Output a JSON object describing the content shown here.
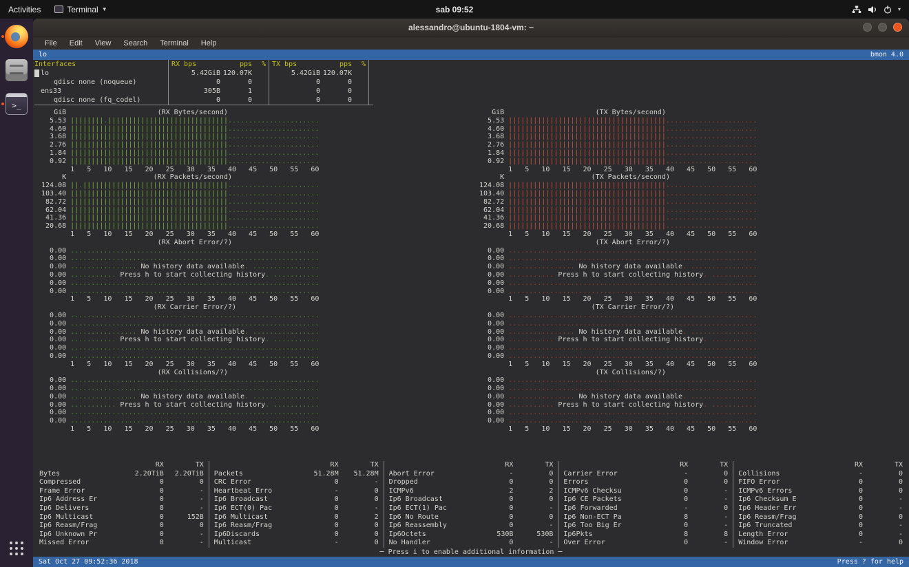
{
  "system_bar": {
    "activities_label": "Activities",
    "app_name": "Terminal",
    "clock": "sab 09:52",
    "tray_icons": [
      "network-icon",
      "volume-icon",
      "power-icon"
    ]
  },
  "dock": {
    "items": [
      {
        "name": "firefox",
        "running": true
      },
      {
        "name": "files",
        "running": false
      },
      {
        "name": "terminal",
        "running": true
      },
      {
        "name": "show-applications",
        "running": false
      }
    ]
  },
  "window": {
    "title": "alessandro@ubuntu-1804-vm: ~",
    "menu_items": [
      "File",
      "Edit",
      "View",
      "Search",
      "Terminal",
      "Help"
    ],
    "controls": [
      "minimize",
      "maximize",
      "close"
    ]
  },
  "bmon": {
    "active_interface": "lo",
    "version_label": "bmon 4.0",
    "interfaces_header": {
      "name": "Interfaces",
      "rx_bps": "RX bps",
      "rx_pps": "pps",
      "rx_pct": "%",
      "tx_bps": "TX bps",
      "tx_pps": "pps",
      "tx_pct": "%"
    },
    "interfaces": [
      {
        "name": "lo",
        "selected": true,
        "indent": 0,
        "rx_bps": "5.42GiB",
        "rx_pps": "120.07K",
        "rx_pct": "",
        "tx_bps": "5.42GiB",
        "tx_pps": "120.07K",
        "tx_pct": ""
      },
      {
        "name": "qdisc none (noqueue)",
        "selected": false,
        "indent": 1,
        "rx_bps": "0",
        "rx_pps": "0",
        "rx_pct": "",
        "tx_bps": "0",
        "tx_pps": "0",
        "tx_pct": ""
      },
      {
        "name": "ens33",
        "selected": false,
        "indent": 0,
        "rx_bps": "305B",
        "rx_pps": "1",
        "rx_pct": "",
        "tx_bps": "0",
        "tx_pps": "0",
        "tx_pct": ""
      },
      {
        "name": "qdisc none (fq_codel)",
        "selected": false,
        "indent": 1,
        "rx_bps": "0",
        "rx_pps": "0",
        "rx_pct": "",
        "tx_bps": "0",
        "tx_pps": "0",
        "tx_pct": ""
      }
    ],
    "axis": "1   5   10   15   20   25   30   35   40   45   50   55   60",
    "history_messages": [
      "No history data available.",
      "Press h to start collecting history."
    ],
    "graphs": [
      {
        "side": "rx",
        "unit": "GiB",
        "title": "(RX Bytes/second)",
        "mode": "bars",
        "fill": 38,
        "gaps": [
          [
            0,
            8
          ]
        ],
        "yticks": [
          "5.53",
          "4.60",
          "3.68",
          "2.76",
          "1.84",
          "0.92"
        ]
      },
      {
        "side": "rx",
        "unit": "K",
        "title": "(RX Packets/second)",
        "mode": "bars",
        "fill": 38,
        "gaps": [
          [
            0,
            2
          ]
        ],
        "yticks": [
          "124.08",
          "103.40",
          "82.72",
          "62.04",
          "41.36",
          "20.68"
        ]
      },
      {
        "side": "rx",
        "unit": "",
        "title": "(RX Abort Error/?)",
        "mode": "history",
        "yticks": [
          "0.00",
          "0.00",
          "0.00",
          "0.00",
          "0.00",
          "0.00"
        ]
      },
      {
        "side": "rx",
        "unit": "",
        "title": "(RX Carrier Error/?)",
        "mode": "history",
        "yticks": [
          "0.00",
          "0.00",
          "0.00",
          "0.00",
          "0.00",
          "0.00"
        ]
      },
      {
        "side": "rx",
        "unit": "",
        "title": "(RX Collisions/?)",
        "mode": "history",
        "yticks": [
          "0.00",
          "0.00",
          "0.00",
          "0.00",
          "0.00",
          "0.00"
        ]
      },
      {
        "side": "tx",
        "unit": "GiB",
        "title": "(TX Bytes/second)",
        "mode": "bars",
        "fill": 38,
        "gaps": [],
        "yticks": [
          "5.53",
          "4.60",
          "3.68",
          "2.76",
          "1.84",
          "0.92"
        ]
      },
      {
        "side": "tx",
        "unit": "K",
        "title": "(TX Packets/second)",
        "mode": "bars",
        "fill": 38,
        "gaps": [],
        "yticks": [
          "124.08",
          "103.40",
          "82.72",
          "62.04",
          "41.36",
          "20.68"
        ]
      },
      {
        "side": "tx",
        "unit": "",
        "title": "(TX Abort Error/?)",
        "mode": "history",
        "yticks": [
          "0.00",
          "0.00",
          "0.00",
          "0.00",
          "0.00",
          "0.00"
        ]
      },
      {
        "side": "tx",
        "unit": "",
        "title": "(TX Carrier Error/?)",
        "mode": "history",
        "yticks": [
          "0.00",
          "0.00",
          "0.00",
          "0.00",
          "0.00",
          "0.00"
        ]
      },
      {
        "side": "tx",
        "unit": "",
        "title": "(TX Collisions/?)",
        "mode": "history",
        "yticks": [
          "0.00",
          "0.00",
          "0.00",
          "0.00",
          "0.00",
          "0.00"
        ]
      }
    ],
    "stats_header": {
      "rx": "RX",
      "tx": "TX"
    },
    "stats_groups": [
      {
        "rows": [
          [
            "Bytes",
            "2.20TiB",
            "2.20TiB"
          ],
          [
            "Compressed",
            "0",
            "0"
          ],
          [
            "Frame Error",
            "0",
            "-"
          ],
          [
            "Ip6 Address Er",
            "0",
            "-"
          ],
          [
            "Ip6 Delivers",
            "8",
            "-"
          ],
          [
            "Ip6 Multicast",
            "0",
            "152B"
          ],
          [
            "Ip6 Reasm/Frag",
            "0",
            "0"
          ],
          [
            "Ip6 Unknown Pr",
            "0",
            "-"
          ],
          [
            "Missed Error",
            "0",
            "-"
          ]
        ]
      },
      {
        "rows": [
          [
            "Packets",
            "51.28M",
            "51.28M"
          ],
          [
            "CRC Error",
            "0",
            "-"
          ],
          [
            "Heartbeat Erro",
            "-",
            "0"
          ],
          [
            "Ip6 Broadcast",
            "0",
            "0"
          ],
          [
            "Ip6 ECT(0) Pac",
            "0",
            "-"
          ],
          [
            "Ip6 Multicast",
            "0",
            "2"
          ],
          [
            "Ip6 Reasm/Frag",
            "0",
            "0"
          ],
          [
            "Ip6Discards",
            "0",
            "0"
          ],
          [
            "Multicast",
            "-",
            "0"
          ]
        ]
      },
      {
        "rows": [
          [
            "Abort Error",
            "-",
            "0"
          ],
          [
            "Dropped",
            "0",
            "0"
          ],
          [
            "ICMPv6",
            "2",
            "2"
          ],
          [
            "Ip6 Broadcast",
            "0",
            "0"
          ],
          [
            "Ip6 ECT(1) Pac",
            "0",
            "-"
          ],
          [
            "Ip6 No Route",
            "0",
            "0"
          ],
          [
            "Ip6 Reassembly",
            "0",
            "-"
          ],
          [
            "Ip6Octets",
            "530B",
            "530B"
          ],
          [
            "No Handler",
            "0",
            "-"
          ]
        ]
      },
      {
        "rows": [
          [
            "Carrier Error",
            "-",
            "0"
          ],
          [
            "Errors",
            "0",
            "0"
          ],
          [
            "ICMPv6 Checksu",
            "0",
            "-"
          ],
          [
            "Ip6 CE Packets",
            "0",
            "-"
          ],
          [
            "Ip6 Forwarded",
            "-",
            "0"
          ],
          [
            "Ip6 Non-ECT Pa",
            "8",
            "-"
          ],
          [
            "Ip6 Too Big Er",
            "0",
            "-"
          ],
          [
            "Ip6Pkts",
            "8",
            "8"
          ],
          [
            "Over Error",
            "0",
            "-"
          ]
        ]
      },
      {
        "rows": [
          [
            "Collisions",
            "-",
            "0"
          ],
          [
            "FIFO Error",
            "0",
            "0"
          ],
          [
            "ICMPv6 Errors",
            "0",
            "0"
          ],
          [
            "Ip6 Checksum E",
            "0",
            "-"
          ],
          [
            "Ip6 Header Err",
            "0",
            "-"
          ],
          [
            "Ip6 Reasm/Frag",
            "0",
            "0"
          ],
          [
            "Ip6 Truncated",
            "0",
            "-"
          ],
          [
            "Length Error",
            "0",
            "-"
          ],
          [
            "Window Error",
            "-",
            "0"
          ]
        ]
      }
    ],
    "stats_note": "─ Press i to enable additional information ─",
    "status_left": "Sat Oct 27 09:52:36 2018",
    "status_right": "Press ? for help"
  },
  "colors": {
    "bmon_bar_bg": "#3465a4",
    "rx_graph": "#6fae3c",
    "tx_graph": "#c8503c",
    "header_yellow": "#c2c21a",
    "close_button": "#e95420"
  }
}
